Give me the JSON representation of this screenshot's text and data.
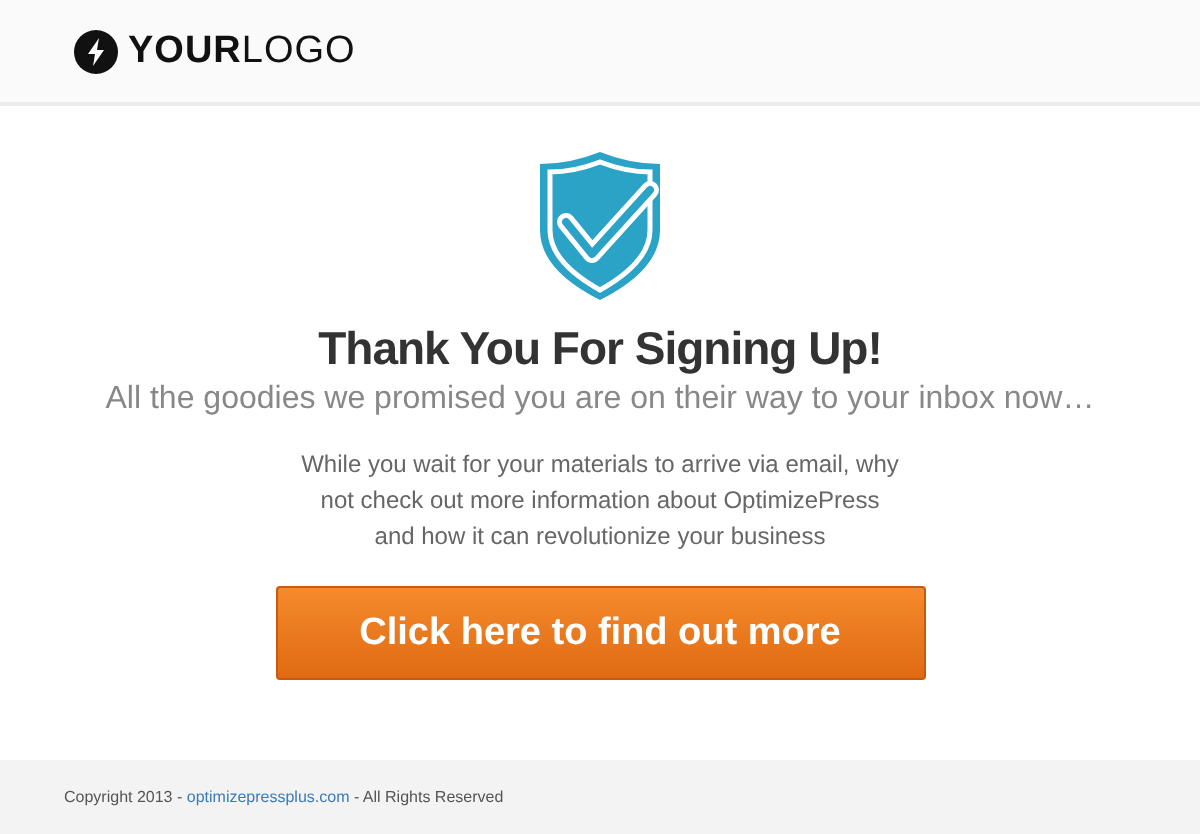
{
  "header": {
    "logo": "**YOUR**LOGO"
  },
  "main": {
    "title": "Thank You For Signing Up!",
    "subtitle": "All the goodies we promised you are on their way to your inbox now…",
    "body": "While you wait for your materials to arrive via email, why not check out more information about  OptimizePress and how it can revolutionize your business",
    "button": "Click here to find out more"
  },
  "footer": {
    "before": "Copyright 2013 - ",
    "link": "optimizepressplus.com",
    "after": " - All Rights Reserved"
  }
}
